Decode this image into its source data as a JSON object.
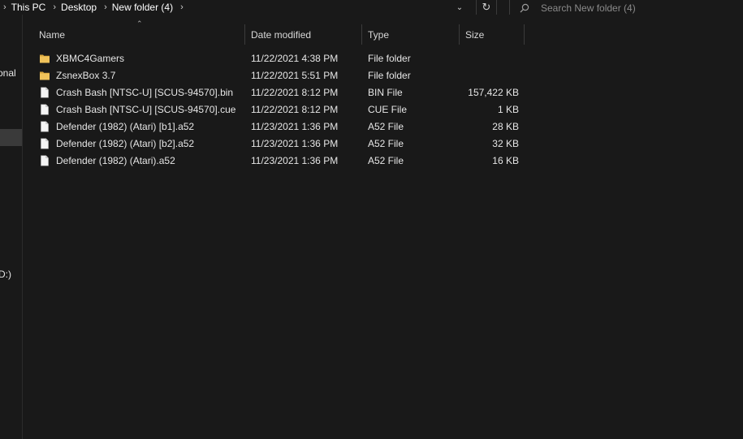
{
  "address": {
    "crumbs": [
      "This PC",
      "Desktop",
      "New folder (4)"
    ]
  },
  "search": {
    "placeholder": "Search New folder (4)"
  },
  "nav": {
    "fragments": [
      "onal",
      "D:)"
    ]
  },
  "columns": {
    "name": "Name",
    "date": "Date modified",
    "type": "Type",
    "size": "Size"
  },
  "files": [
    {
      "name": "XBMC4Gamers",
      "date": "11/22/2021 4:38 PM",
      "type": "File folder",
      "size": "",
      "icon": "folder-icon"
    },
    {
      "name": "ZsnexBox 3.7",
      "date": "11/22/2021 5:51 PM",
      "type": "File folder",
      "size": "",
      "icon": "folder-icon"
    },
    {
      "name": "Crash Bash [NTSC-U] [SCUS-94570].bin",
      "date": "11/22/2021 8:12 PM",
      "type": "BIN File",
      "size": "157,422 KB",
      "icon": "file-icon"
    },
    {
      "name": "Crash Bash [NTSC-U] [SCUS-94570].cue",
      "date": "11/22/2021 8:12 PM",
      "type": "CUE File",
      "size": "1 KB",
      "icon": "file-icon"
    },
    {
      "name": "Defender (1982) (Atari) [b1].a52",
      "date": "11/23/2021 1:36 PM",
      "type": "A52 File",
      "size": "28 KB",
      "icon": "file-icon"
    },
    {
      "name": "Defender (1982) (Atari) [b2].a52",
      "date": "11/23/2021 1:36 PM",
      "type": "A52 File",
      "size": "32 KB",
      "icon": "file-icon"
    },
    {
      "name": "Defender (1982) (Atari).a52",
      "date": "11/23/2021 1:36 PM",
      "type": "A52 File",
      "size": "16 KB",
      "icon": "file-icon"
    }
  ],
  "colors": {
    "background": "#191919",
    "folder": "#e8b64c",
    "text": "#e6e6e6"
  }
}
